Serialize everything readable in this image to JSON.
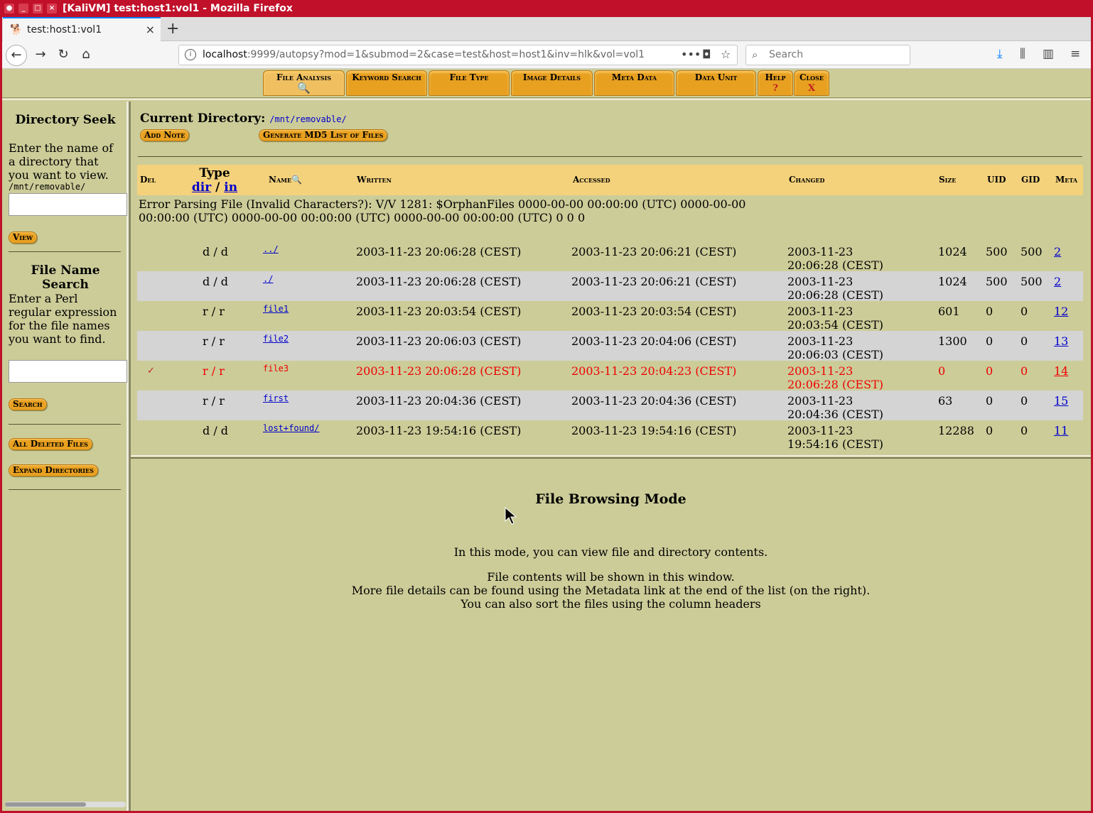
{
  "window": {
    "title": "[KaliVM] test:host1:vol1 - Mozilla Firefox"
  },
  "browser": {
    "tab_title": "test:host1:vol1",
    "url_host": "localhost",
    "url_rest": ":9999/autopsy?mod=1&submod=2&case=test&host=host1&inv=hlk&vol=vol1",
    "search_placeholder": "Search"
  },
  "menu": {
    "tabs": [
      {
        "label": "File Analysis",
        "glyph": "magnifier-icon"
      },
      {
        "label": "Keyword Search"
      },
      {
        "label": "File Type"
      },
      {
        "label": "Image Details"
      },
      {
        "label": "Meta Data"
      },
      {
        "label": "Data Unit"
      },
      {
        "label": "Help",
        "glyph": "?"
      },
      {
        "label": "Close",
        "glyph": "X"
      }
    ]
  },
  "sidebar": {
    "dir_seek_title": "Directory Seek",
    "dir_seek_text": "Enter the name of a directory that you want to view.",
    "dir_seek_path": "/mnt/removable/",
    "view_button": "View",
    "name_search_title": "File Name Search",
    "name_search_text": "Enter a Perl regular expression for the file names you want to find.",
    "search_button": "Search",
    "all_deleted_button": "All Deleted Files",
    "expand_dirs_button": "Expand Directories"
  },
  "listing": {
    "current_dir_label": "Current Directory:",
    "current_dir_path": "/mnt/removable/",
    "add_note_button": "Add Note",
    "md5_button": "Generate MD5 List of Files",
    "headers": {
      "del": "Del",
      "type": "Type",
      "type_dir": "dir",
      "type_slash": "/",
      "type_in": "in",
      "name": "Name",
      "written": "Written",
      "accessed": "Accessed",
      "changed": "Changed",
      "size": "Size",
      "uid": "UID",
      "gid": "GID",
      "meta": "Meta"
    },
    "error_text": "Error Parsing File (Invalid Characters?): V/V 1281: $OrphanFiles 0000-00-00 00:00:00 (UTC) 0000-00-00 00:00:00 (UTC) 0000-00-00 00:00:00 (UTC) 0000-00-00 00:00:00 (UTC) 0 0 0",
    "rows": [
      {
        "del": "",
        "type": "d / d",
        "name": "../",
        "written": "2003-11-23 20:06:28 (CEST)",
        "accessed": "2003-11-23 20:06:21 (CEST)",
        "changed": "2003-11-23 20:06:28 (CEST)",
        "size": "1024",
        "uid": "500",
        "gid": "500",
        "meta": "2"
      },
      {
        "del": "",
        "type": "d / d",
        "name": "./",
        "written": "2003-11-23 20:06:28 (CEST)",
        "accessed": "2003-11-23 20:06:21 (CEST)",
        "changed": "2003-11-23 20:06:28 (CEST)",
        "size": "1024",
        "uid": "500",
        "gid": "500",
        "meta": "2"
      },
      {
        "del": "",
        "type": "r / r",
        "name": "file1",
        "written": "2003-11-23 20:03:54 (CEST)",
        "accessed": "2003-11-23 20:03:54 (CEST)",
        "changed": "2003-11-23 20:03:54 (CEST)",
        "size": "601",
        "uid": "0",
        "gid": "0",
        "meta": "12"
      },
      {
        "del": "",
        "type": "r / r",
        "name": "file2",
        "written": "2003-11-23 20:06:03 (CEST)",
        "accessed": "2003-11-23 20:04:06 (CEST)",
        "changed": "2003-11-23 20:06:03 (CEST)",
        "size": "1300",
        "uid": "0",
        "gid": "0",
        "meta": "13"
      },
      {
        "del": "✓",
        "type": "r / r",
        "name": "file3",
        "written": "2003-11-23 20:06:28 (CEST)",
        "accessed": "2003-11-23 20:04:23 (CEST)",
        "changed": "2003-11-23 20:06:28 (CEST)",
        "size": "0",
        "uid": "0",
        "gid": "0",
        "meta": "14"
      },
      {
        "del": "",
        "type": "r / r",
        "name": "first",
        "written": "2003-11-23 20:04:36 (CEST)",
        "accessed": "2003-11-23 20:04:36 (CEST)",
        "changed": "2003-11-23 20:04:36 (CEST)",
        "size": "63",
        "uid": "0",
        "gid": "0",
        "meta": "15"
      },
      {
        "del": "",
        "type": "d / d",
        "name": "lost+found/",
        "written": "2003-11-23 19:54:16 (CEST)",
        "accessed": "2003-11-23 19:54:16 (CEST)",
        "changed": "2003-11-23 19:54:16 (CEST)",
        "size": "12288",
        "uid": "0",
        "gid": "0",
        "meta": "11"
      }
    ]
  },
  "content": {
    "title": "File Browsing Mode",
    "line1": "In this mode, you can view file and directory contents.",
    "line2": "File contents will be shown in this window.",
    "line3": "More file details can be found using the Metadata link at the end of the list (on the right).",
    "line4": "You can also sort the files using the column headers"
  },
  "colors": {
    "background": "#cccc99",
    "header_row": "#f4d27c",
    "alt_row": "#d4d4d4",
    "button_orange": "#e8a020",
    "deleted_red": "#ee0000",
    "link_blue": "#0000cc",
    "window_red": "#c0102a"
  }
}
